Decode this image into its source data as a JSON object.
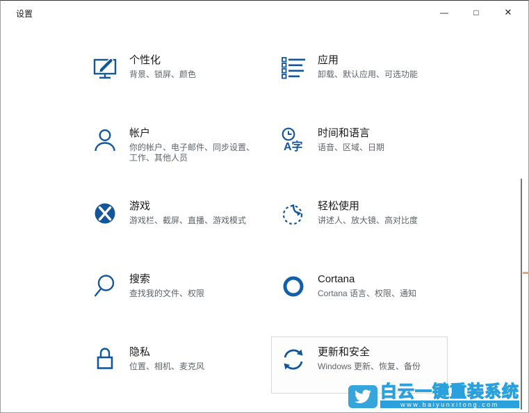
{
  "window": {
    "title": "设置",
    "controls": {
      "minimize": "—",
      "maximize": "□",
      "close": "✕"
    }
  },
  "tiles": [
    {
      "id": "personalization",
      "title": "个性化",
      "subtitle": "背景、锁屏、颜色"
    },
    {
      "id": "apps",
      "title": "应用",
      "subtitle": "卸载、默认应用、可选功能"
    },
    {
      "id": "accounts",
      "title": "帐户",
      "subtitle": "你的帐户、电子邮件、同步设置、工作、其他人员"
    },
    {
      "id": "time-language",
      "title": "时间和语言",
      "subtitle": "语音、区域、日期",
      "icon_text": "A字"
    },
    {
      "id": "gaming",
      "title": "游戏",
      "subtitle": "游戏栏、截屏、直播、游戏模式"
    },
    {
      "id": "ease-of-access",
      "title": "轻松使用",
      "subtitle": "讲述人、放大镜、高对比度"
    },
    {
      "id": "search",
      "title": "搜索",
      "subtitle": "查找我的文件、权限"
    },
    {
      "id": "cortana",
      "title": "Cortana",
      "subtitle": "Cortana 语言、权限、通知"
    },
    {
      "id": "privacy",
      "title": "隐私",
      "subtitle": "位置、相机、麦克风"
    },
    {
      "id": "update-security",
      "title": "更新和安全",
      "subtitle": "Windows 更新、恢复、备份"
    }
  ],
  "watermark": {
    "brand": "白云一键重装系统",
    "url": "www.baiyunxitong.com"
  },
  "colors": {
    "icon_blue": "#14569b",
    "watermark_blue": "#2aa0dc",
    "highlight_border": "#d9d9d9"
  }
}
